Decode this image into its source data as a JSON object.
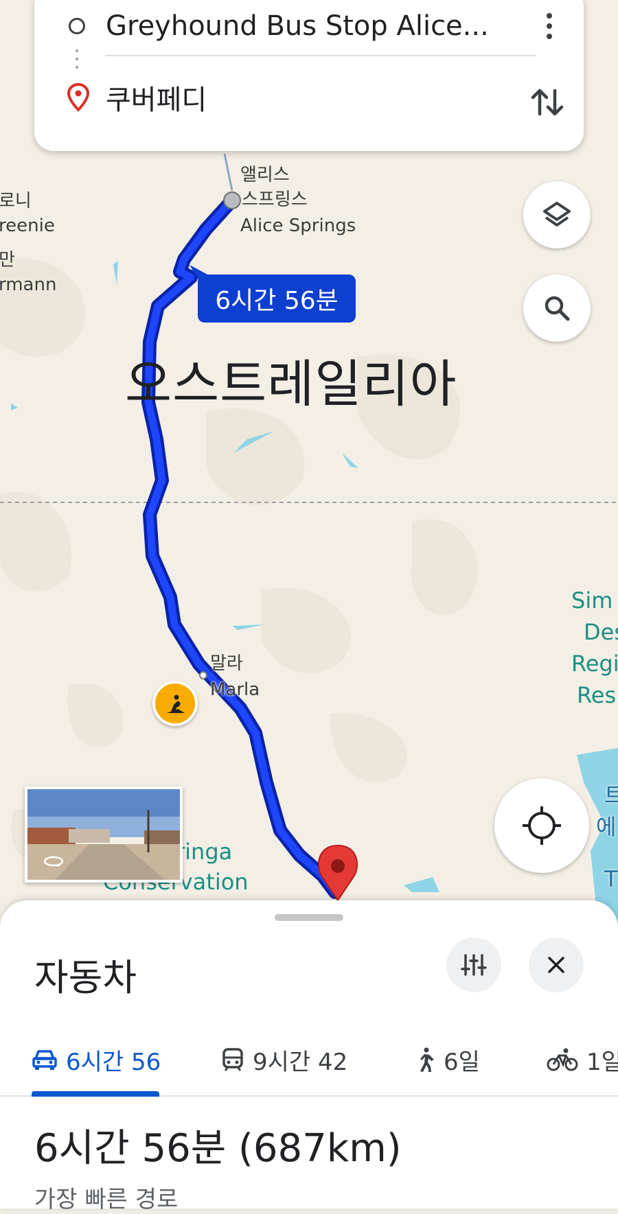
{
  "search": {
    "origin": "Greyhound Bus Stop Alice...",
    "destination": "쿠버페디"
  },
  "map": {
    "country_label": "오스트레일리아",
    "places": {
      "alice_ko": "앨리스",
      "alice_ko2": "스프링스",
      "alice_en": "Alice Springs",
      "marla_ko": "말라",
      "marla_en": "Marla",
      "left1": "로니",
      "left2": "reenie",
      "left3": "만",
      "left4": "rmann",
      "park1": "ringa",
      "park2": "Conservation",
      "sim1": "Sim",
      "sim2": "Des",
      "sim3": "Regi",
      "sim4": "Res",
      "lake1": "트",
      "lake2": "에",
      "lake3": "T"
    },
    "route_badge": "6시간 56분",
    "route_color": "#1a3fe0"
  },
  "sheet": {
    "mode_title": "자동차",
    "tabs": [
      {
        "icon": "car-icon",
        "label": "6시간 56"
      },
      {
        "icon": "transit-icon",
        "label": "9시간 42"
      },
      {
        "icon": "walk-icon",
        "label": "6일"
      },
      {
        "icon": "bike-icon",
        "label": "1일"
      }
    ],
    "summary": "6시간 56분 (687km)",
    "subtitle": "가장 빠른 경로"
  }
}
